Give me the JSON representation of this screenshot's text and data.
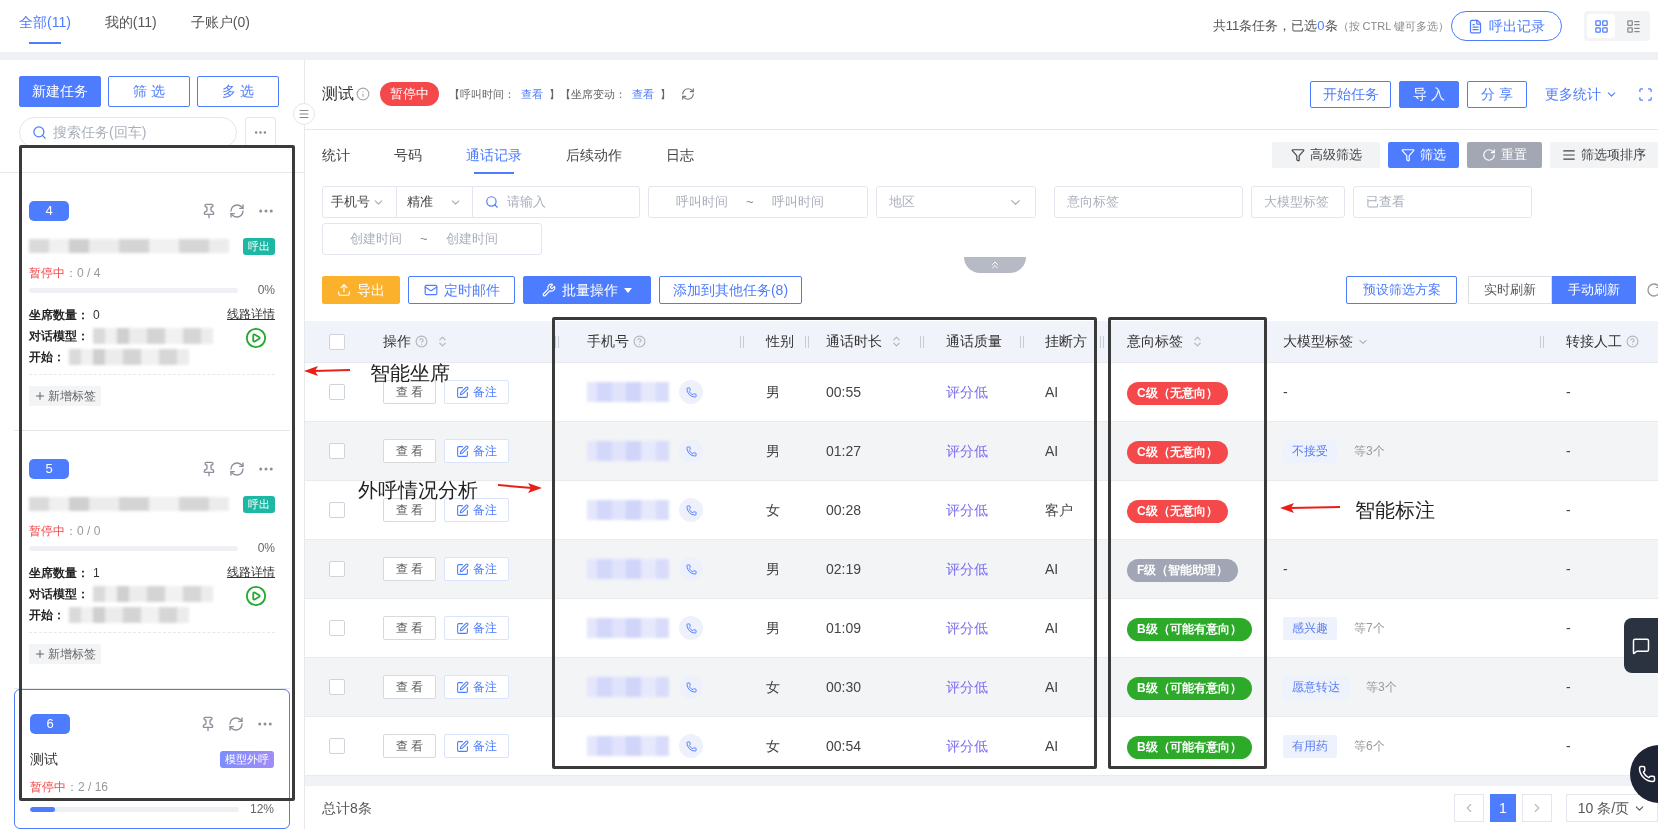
{
  "top_tabs": [
    {
      "label": "全部(11)",
      "selected": true
    },
    {
      "label": "我的(11)",
      "selected": false
    },
    {
      "label": "子账户(0)",
      "selected": false
    }
  ],
  "summary": {
    "text": "共11条任务，已选",
    "count": "0",
    "unit": "条",
    "hint": "（按 CTRL 键可多选）"
  },
  "call_log_button": "呼出记录",
  "view_toggle": [
    {
      "kind": "grid",
      "selected": true
    },
    {
      "kind": "list",
      "selected": false
    }
  ],
  "sidebar": {
    "buttons": [
      {
        "label": "新建任务",
        "kind": "primary"
      },
      {
        "label": "筛 选",
        "kind": "outline"
      },
      {
        "label": "多 选",
        "kind": "outline"
      }
    ],
    "search": {
      "placeholder": "搜索任务(回车)"
    }
  },
  "tasks": [
    {
      "badge": "4",
      "selected": false,
      "name_redacted": true,
      "tag": {
        "label": "呼出",
        "kind": "outbound"
      },
      "status": "暂停中",
      "progress": "：0 / 4",
      "level": 0,
      "percent": "0%",
      "fields": [
        {
          "label": "坐席数量：",
          "value": "0"
        },
        {
          "label": "对话模型：",
          "redacted": true
        },
        {
          "label": "开始：",
          "redacted": true
        }
      ],
      "line_link": "线路详情",
      "add_tag": "新增标签"
    },
    {
      "badge": "5",
      "selected": false,
      "name_redacted": true,
      "tag": {
        "label": "呼出",
        "kind": "outbound"
      },
      "status": "暂停中",
      "progress": "：0 / 0",
      "level": 0,
      "percent": "0%",
      "fields": [
        {
          "label": "坐席数量：",
          "value": "1"
        },
        {
          "label": "对话模型：",
          "redacted": true
        },
        {
          "label": "开始：",
          "redacted": true
        }
      ],
      "line_link": "线路详情",
      "add_tag": "新增标签"
    },
    {
      "badge": "6",
      "selected": true,
      "name": "测试",
      "tag": {
        "label": "模型外呼",
        "kind": "model"
      },
      "status": "暂停中",
      "progress": "：2 / 16",
      "level": 0.12,
      "percent": "12%"
    }
  ],
  "header": {
    "title": "测试",
    "status": "暂停中",
    "meta": [
      {
        "kind": "text",
        "text": "【呼叫时间："
      },
      {
        "kind": "link",
        "text": "查看"
      },
      {
        "kind": "text",
        "text": "】【坐席变动："
      },
      {
        "kind": "link",
        "text": "查看"
      },
      {
        "kind": "text",
        "text": "】"
      }
    ],
    "buttons": [
      {
        "label": "开始任务",
        "kind": "outline"
      },
      {
        "label": "导 入",
        "kind": "primary"
      },
      {
        "label": "分 享",
        "kind": "outline"
      }
    ],
    "more_stats": "更多统计"
  },
  "tabs": [
    {
      "label": "统计",
      "selected": false
    },
    {
      "label": "号码",
      "selected": false
    },
    {
      "label": "通话记录",
      "selected": true
    },
    {
      "label": "后续动作",
      "selected": false
    },
    {
      "label": "日志",
      "selected": false
    }
  ],
  "filter_buttons": [
    {
      "label": "高级筛选",
      "kind": "advanced"
    },
    {
      "label": "筛选",
      "kind": "filter"
    },
    {
      "label": "重置",
      "kind": "reset"
    },
    {
      "label": "筛选项排序",
      "kind": "sort"
    }
  ],
  "filters": [
    {
      "kind": "search",
      "field": "手机号",
      "match": "精准",
      "placeholder": "请输入"
    },
    {
      "kind": "range",
      "from": "呼叫时间",
      "separator": "~",
      "to": "呼叫时间"
    },
    {
      "kind": "select",
      "placeholder": "地区"
    },
    {
      "kind": "input",
      "placeholder": "意向标签"
    },
    {
      "kind": "input",
      "placeholder": "大模型标签"
    },
    {
      "kind": "input",
      "placeholder": "已查看"
    },
    {
      "kind": "range",
      "from": "创建时间",
      "separator": "~",
      "to": "创建时间"
    }
  ],
  "actions": [
    {
      "label": "导出",
      "kind": "export"
    },
    {
      "label": "定时邮件",
      "kind": "mail"
    },
    {
      "label": "批量操作",
      "kind": "batch"
    },
    {
      "label": "添加到其他任务(8)",
      "kind": "add"
    }
  ],
  "preset_button": "预设筛选方案",
  "refresh_modes": [
    {
      "label": "实时刷新",
      "selected": false
    },
    {
      "label": "手动刷新",
      "selected": true
    }
  ],
  "table": {
    "header_checked": false,
    "columns": [
      {
        "label": "操作",
        "help": true,
        "sortable": true
      },
      {
        "label": "手机号",
        "help": true
      },
      {
        "label": "性别"
      },
      {
        "label": "通话时长",
        "sortable": true
      },
      {
        "label": "通话质量"
      },
      {
        "label": "挂断方"
      },
      {
        "label": "意向标签",
        "sortable": true
      },
      {
        "label": "大模型标签",
        "dropdown": true
      },
      {
        "label": "转接人工",
        "help": true
      }
    ],
    "rows": [
      {
        "checked": false,
        "view": "查 看",
        "note": "备注",
        "gender": "男",
        "duration": "00:55",
        "quality": "评分低",
        "hangup": "AI",
        "intent": {
          "label": "C级（无意向）",
          "color": "#f5484a"
        },
        "llm": {
          "kind": "none",
          "text": "-"
        },
        "transfer": "-"
      },
      {
        "checked": false,
        "view": "查 看",
        "note": "备注",
        "gender": "男",
        "duration": "01:27",
        "quality": "评分低",
        "hangup": "AI",
        "intent": {
          "label": "C级（无意向）",
          "color": "#f5484a"
        },
        "llm": {
          "kind": "tag",
          "text": "不接受",
          "more": "等3个"
        },
        "transfer": "-"
      },
      {
        "checked": false,
        "view": "查 看",
        "note": "备注",
        "gender": "女",
        "duration": "00:28",
        "quality": "评分低",
        "hangup": "客户",
        "intent": {
          "label": "C级（无意向）",
          "color": "#f5484a"
        },
        "transfer": "-"
      },
      {
        "checked": false,
        "view": "查 看",
        "note": "备注",
        "gender": "男",
        "duration": "02:19",
        "quality": "评分低",
        "hangup": "AI",
        "intent": {
          "label": "F级（智能助理）",
          "color": "#a2a6b4"
        },
        "llm": {
          "kind": "none",
          "text": "-"
        },
        "transfer": "-"
      },
      {
        "checked": false,
        "view": "查 看",
        "note": "备注",
        "gender": "男",
        "duration": "01:09",
        "quality": "评分低",
        "hangup": "AI",
        "intent": {
          "label": "B级（可能有意向）",
          "color": "#2daa2a"
        },
        "llm": {
          "kind": "tag",
          "text": "感兴趣",
          "more": "等7个"
        },
        "transfer": "-"
      },
      {
        "checked": false,
        "view": "查 看",
        "note": "备注",
        "gender": "女",
        "duration": "00:30",
        "quality": "评分低",
        "hangup": "AI",
        "intent": {
          "label": "B级（可能有意向）",
          "color": "#2daa2a"
        },
        "llm": {
          "kind": "tag",
          "text": "愿意转达",
          "more": "等3个"
        },
        "transfer": "-"
      },
      {
        "checked": false,
        "view": "查 看",
        "note": "备注",
        "gender": "女",
        "duration": "00:54",
        "quality": "评分低",
        "hangup": "AI",
        "intent": {
          "label": "B级（可能有意向）",
          "color": "#2daa2a"
        },
        "llm": {
          "kind": "tag",
          "text": "有用药",
          "more": "等6个"
        },
        "transfer": "-"
      }
    ]
  },
  "footer": {
    "total": "总计8条",
    "pages": [
      {
        "label": "1",
        "selected": true
      }
    ],
    "page_size": "10 条/页"
  },
  "annotations": [
    {
      "text": "智能坐席"
    },
    {
      "text": "外呼情况分析"
    },
    {
      "text": "智能标注"
    }
  ]
}
